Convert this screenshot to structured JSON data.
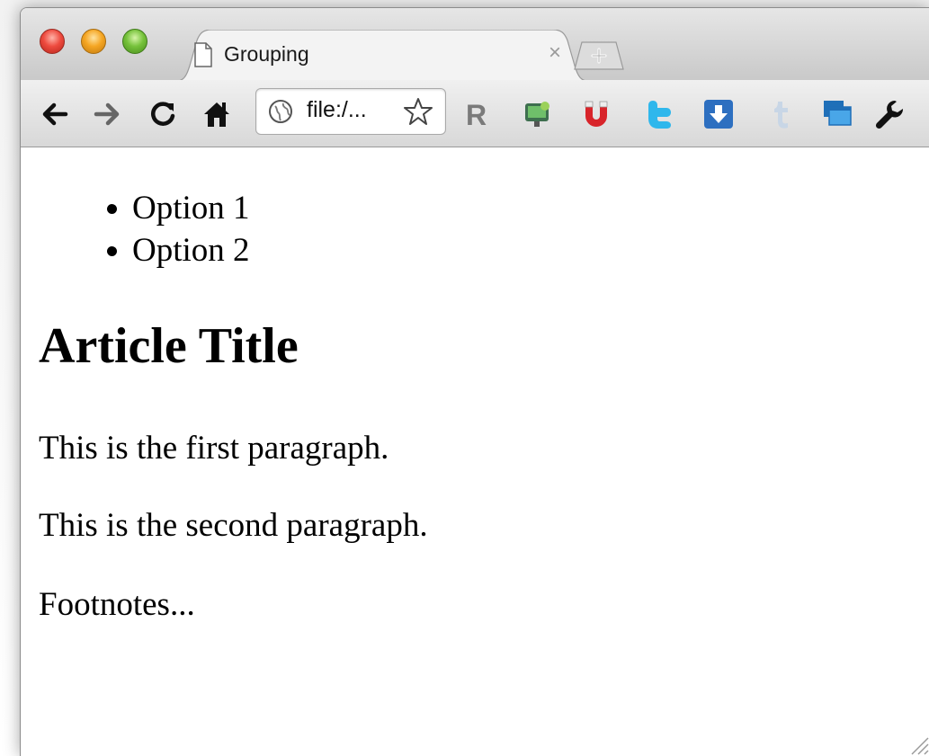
{
  "browser": {
    "tab": {
      "title": "Grouping",
      "close_glyph": "×",
      "icon": "document-icon"
    },
    "new_tab_icon": "new-tab-icon",
    "toolbar": {
      "back_icon": "back-arrow-icon",
      "forward_icon": "forward-arrow-icon",
      "reload_icon": "reload-icon",
      "home_icon": "home-icon",
      "address": "file:/...",
      "bookmark_icon": "star-icon",
      "extensions": [
        "R-extension-icon",
        "screen-capture-extension-icon",
        "magnet-extension-icon",
        "twitter-extension-icon",
        "download-extension-icon",
        "tumblr-extension-icon",
        "windows-extension-icon"
      ],
      "wrench_icon": "wrench-icon"
    }
  },
  "page": {
    "list": [
      "Option 1",
      "Option 2"
    ],
    "article_title": "Article Title",
    "paragraphs": [
      "This is the first paragraph.",
      "This is the second paragraph.",
      "Footnotes..."
    ]
  },
  "colors": {
    "close_button": "#ee4b3f",
    "minimize_button": "#f5a623",
    "zoom_button": "#76c23b",
    "twitter_blue": "#2fb7ec",
    "download_blue": "#2d6fc0",
    "magnet_red": "#d8242a"
  }
}
